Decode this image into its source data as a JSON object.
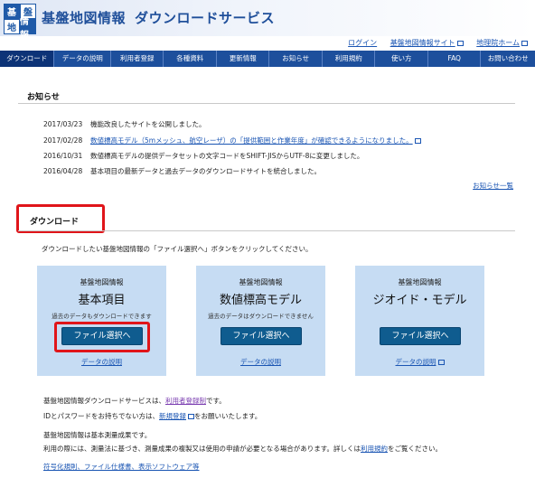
{
  "header": {
    "logo_chars": [
      "基",
      "盤",
      "地",
      "情報"
    ],
    "title": "基盤地図情報",
    "subtitle": "ダウンロードサービス",
    "links": [
      "ログイン",
      "基盤地図情報サイト",
      "地理院ホーム"
    ]
  },
  "nav": {
    "items": [
      "ダウンロード",
      "データの説明",
      "利用者登録",
      "各種資料",
      "更新情報",
      "お知らせ",
      "利用規約",
      "使い方",
      "FAQ",
      "お問い合わせ"
    ]
  },
  "news": {
    "title": "お知らせ",
    "items": [
      {
        "date": "2017/03/23",
        "text": "機能改良したサイトを公開しました。"
      },
      {
        "date": "2017/02/28",
        "text": "数値標高モデル（5mメッシュ、航空レーザ）の「提供範囲と作業年度」が確認できるようになりました。"
      },
      {
        "date": "2016/10/31",
        "text": "数値標高モデルの提供データセットの文字コードをSHIFT-JISからUTF-8に変更しました。"
      },
      {
        "date": "2016/04/28",
        "text": "基本項目の最新データと過去データのダウンロードサイトを統合しました。"
      }
    ],
    "more": "お知らせ一覧"
  },
  "download": {
    "title": "ダウンロード",
    "intro": "ダウンロードしたい基盤地図情報の「ファイル選択へ」ボタンをクリックしてください。",
    "cards": [
      {
        "sys": "基盤地図情報",
        "name": "基本項目",
        "note": "過去のデータもダウンロードできます",
        "button": "ファイル選択へ",
        "link": "データの説明"
      },
      {
        "sys": "基盤地図情報",
        "name": "数値標高モデル",
        "note": "過去のデータはダウンロードできません",
        "button": "ファイル選択へ",
        "link": "データの説明"
      },
      {
        "sys": "基盤地図情報",
        "name": "ジオイド・モデル",
        "note": "",
        "button": "ファイル選択へ",
        "link": "データの説明"
      }
    ]
  },
  "footer": {
    "l1_pre": "基盤地図情報ダウンロードサービスは、",
    "l1_link": "利用者登録制",
    "l1_post": "です。",
    "l2_pre": "IDとパスワードをお持ちでない方は、",
    "l2_link": "新規登録",
    "l2_post": "をお願いいたします。",
    "l3": "基盤地図情報は基本測量成果です。",
    "l4_pre": "利用の際には、測量法に基づき、測量成果の複製又は使用の申請が必要となる場合があります。詳しくは",
    "l4_link": "利用規約",
    "l4_post": "をご覧ください。",
    "bottom_link": "符号化規則、ファイル仕様書、表示ソフトウェア等"
  },
  "colors": {
    "nav": "#1d4f9c",
    "nav_active": "#0d3377",
    "card": "#c6dcf3",
    "button": "#0f5c8f",
    "highlight": "#e0151a",
    "link": "#1a55b3"
  }
}
